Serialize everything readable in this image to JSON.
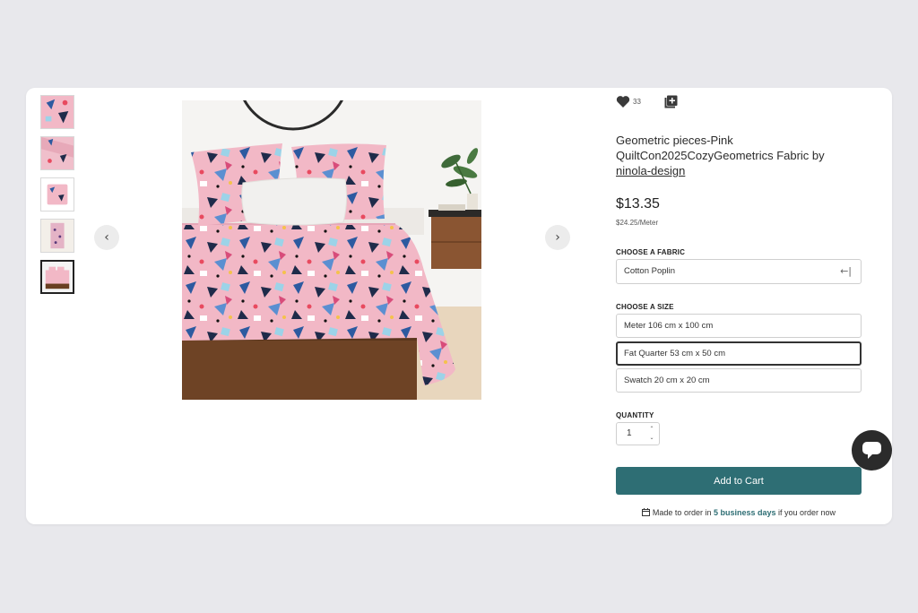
{
  "gallery": {
    "prev_label": "‹",
    "next_label": "›",
    "thumbnails": [
      "swatch",
      "fabric-fold",
      "pillow",
      "tea-towel",
      "duvet-cover"
    ],
    "active_thumbnail": 5
  },
  "product": {
    "likes": "33",
    "title_line1": "Geometric pieces-Pink",
    "title_line2": "QuiltCon2025CozyGeometrics Fabric by ",
    "designer": "ninola-design",
    "price": "$13.35",
    "unit_price": "$24.25/Meter"
  },
  "fabric": {
    "label": "CHOOSE A FABRIC",
    "selected": "Cotton Poplin",
    "arrow": "←|"
  },
  "size": {
    "label": "CHOOSE A SIZE",
    "options": [
      "Meter 106 cm x 100 cm",
      "Fat Quarter 53 cm x 50 cm",
      "Swatch 20 cm x 20 cm"
    ],
    "selected_index": 1
  },
  "quantity": {
    "label": "QUANTITY",
    "value": "1",
    "up": "⌃",
    "down": "⌄"
  },
  "cart": {
    "button_label": "Add to Cart",
    "made_prefix": "Made to order in ",
    "made_days": "5 business days",
    "made_suffix": " if you order now"
  },
  "colors": {
    "accent": "#2e6e74",
    "fabric_pink": "#f2b8c6",
    "chat_bg": "#2b2b2b"
  }
}
